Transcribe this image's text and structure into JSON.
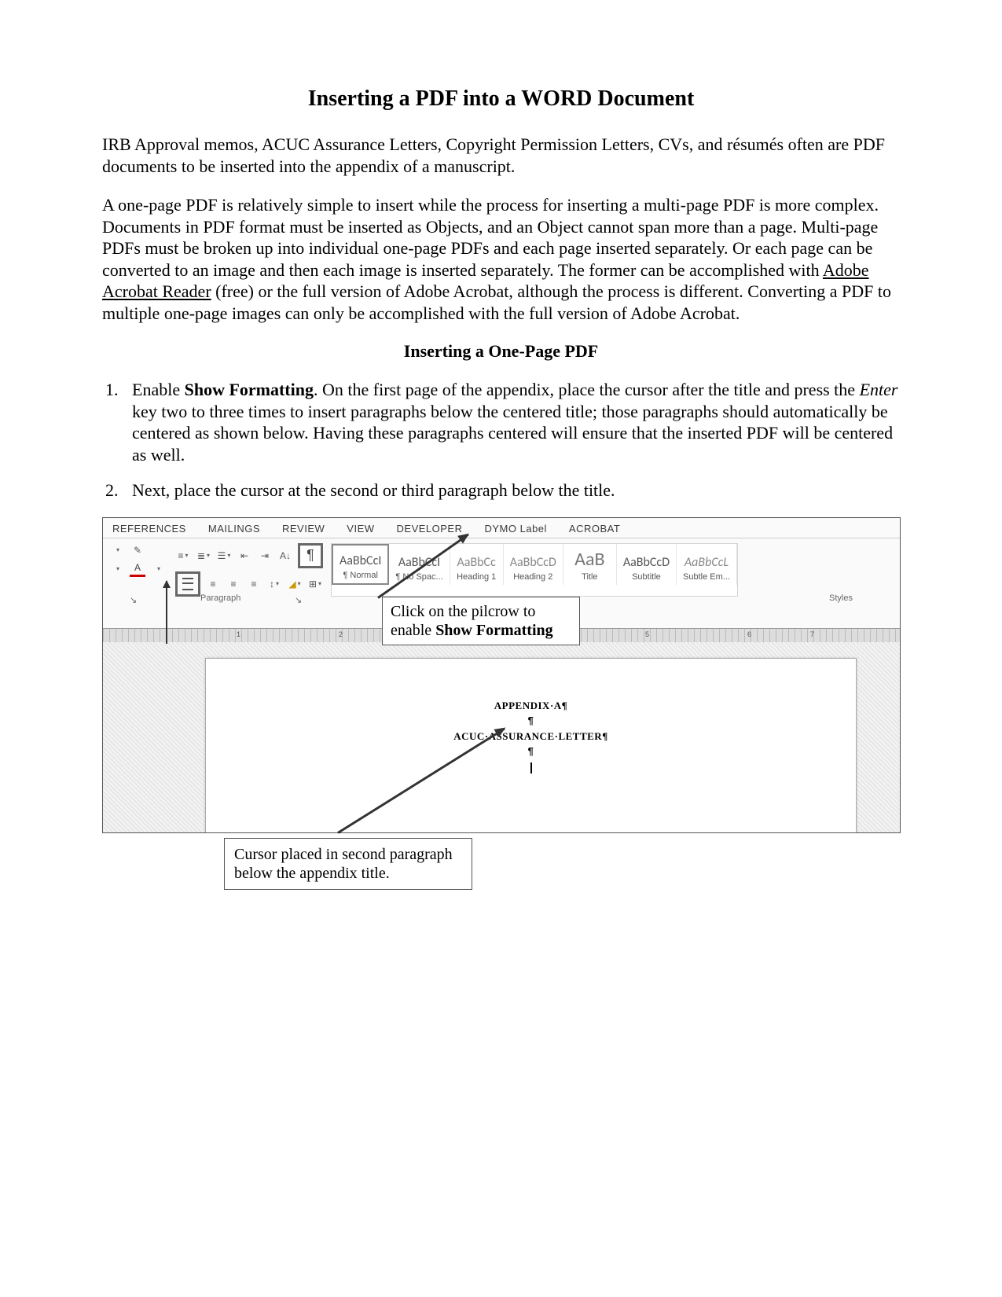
{
  "title": "Inserting a PDF into a WORD Document",
  "intro1": "IRB Approval memos, ACUC Assurance Letters, Copyright Permission Letters, CVs, and résumés often are PDF documents to be inserted into the appendix of a manuscript.",
  "intro2_pre": "A one-page PDF is relatively simple to insert while the process for inserting a multi-page PDF is more complex. Documents in PDF format must be inserted as Objects, and an Object cannot span more than a page. Multi-page PDFs must be broken up into individual one-page PDFs and each page inserted separately. Or each page can be converted to an image and then each image is inserted separately. The former can be accomplished with ",
  "intro2_link": "Adobe Acrobat Reader",
  "intro2_post": " (free) or the full version of Adobe Acrobat, although the process is different. Converting a PDF to multiple one-page images can only be accomplished with the full version of Adobe Acrobat.",
  "section": "Inserting a One-Page PDF",
  "step1_lead": "Enable ",
  "step1_bold": "Show Formatting",
  "step1_rest_a": ". On the first page of the appendix, place the cursor after the title and press the ",
  "step1_italic": "Enter",
  "step1_rest_b": " key two to three times to insert paragraphs below the centered title; those paragraphs should automatically be centered as shown below. Having these paragraphs centered will ensure that the inserted PDF will be centered as well.",
  "step2": "Next, place the cursor at the second or third paragraph below the title.",
  "ribbon": {
    "tabs": [
      "REFERENCES",
      "MAILINGS",
      "REVIEW",
      "VIEW",
      "DEVELOPER",
      "DYMO Label",
      "ACROBAT"
    ],
    "styles": [
      {
        "preview": "AaBbCcI",
        "label": "¶ Normal",
        "cls": "normal"
      },
      {
        "preview": "AaBbCcI",
        "label": "¶ No Spac...",
        "cls": ""
      },
      {
        "preview": "AaBbCc",
        "label": "Heading 1",
        "cls": "h1"
      },
      {
        "preview": "AaBbCcD",
        "label": "Heading 2",
        "cls": "h2"
      },
      {
        "preview": "AaB",
        "label": "Title",
        "cls": "title"
      },
      {
        "preview": "AaBbCcD",
        "label": "Subtitle",
        "cls": ""
      },
      {
        "preview": "AaBbCcL",
        "label": "Subtle Em...",
        "cls": "subtle"
      }
    ],
    "group_paragraph": "Paragraph",
    "group_styles": "Styles"
  },
  "callout1_a": "Click on the pilcrow to",
  "callout1_b_pre": "enable ",
  "callout1_b_bold": "Show Formatting",
  "doc_line1": "APPENDIX·A¶",
  "doc_line2": "¶",
  "doc_line3": "ACUC·ASSURANCE·LETTER¶",
  "doc_line4": "¶",
  "callout2": "Cursor placed in second paragraph below the appendix title."
}
